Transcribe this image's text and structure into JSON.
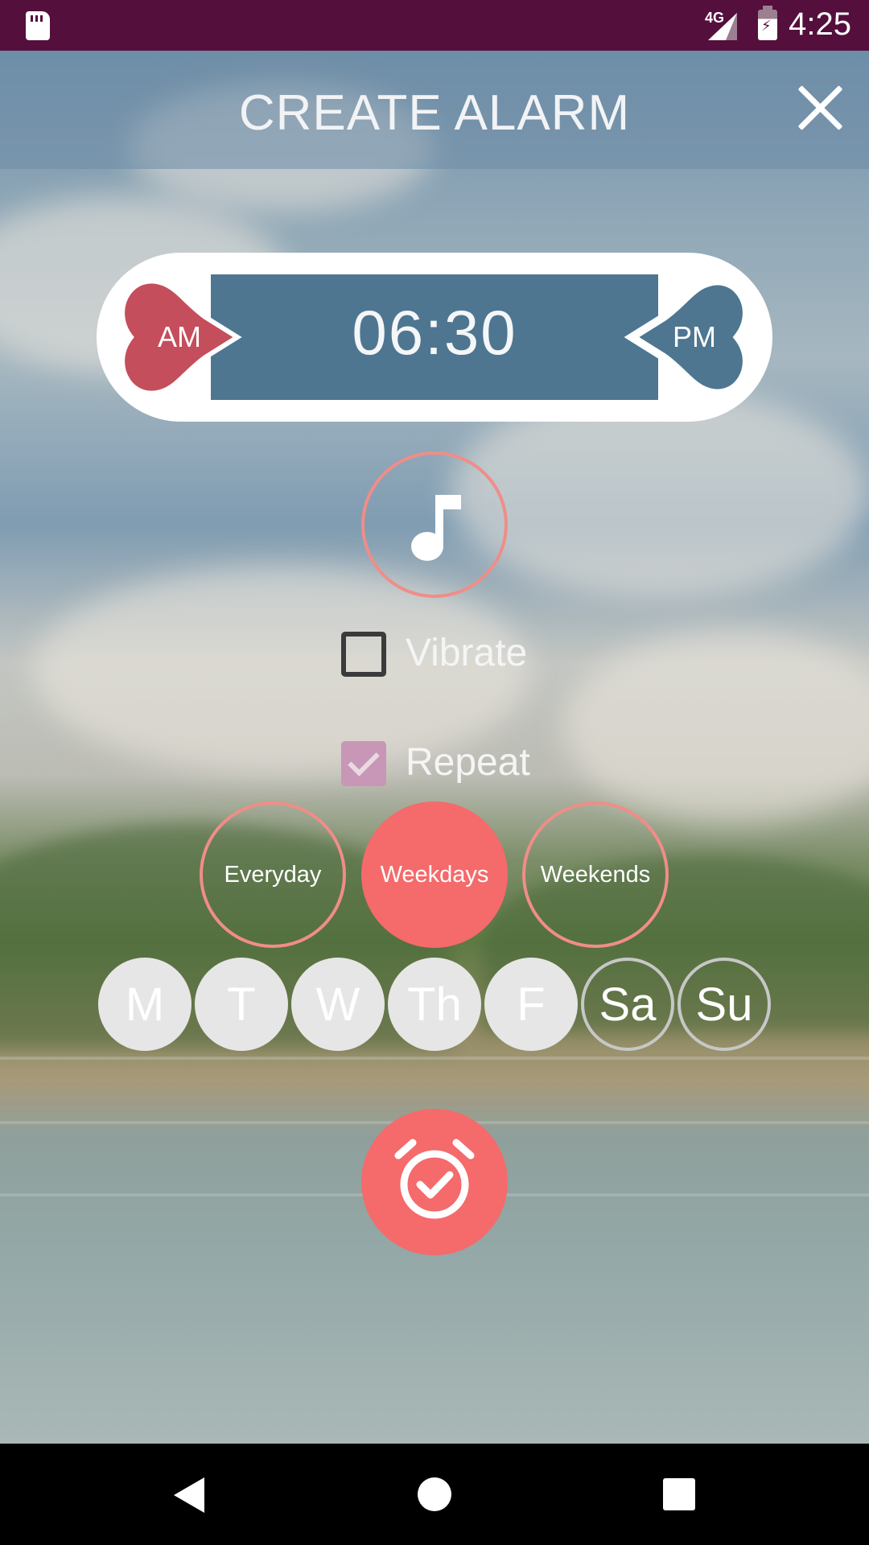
{
  "status_bar": {
    "network": "4G",
    "time": "4:25",
    "icons": [
      "sd-card-icon",
      "signal-icon",
      "battery-charging-icon"
    ]
  },
  "header": {
    "title": "CREATE ALARM",
    "close_icon": "close-icon"
  },
  "time_picker": {
    "time": "06:30",
    "am_label": "AM",
    "pm_label": "PM",
    "selected_period": "AM"
  },
  "sound": {
    "icon": "music-note-icon"
  },
  "vibrate": {
    "label": "Vibrate",
    "checked": false
  },
  "repeat": {
    "label": "Repeat",
    "checked": true,
    "presets": [
      {
        "label": "Everyday",
        "active": false
      },
      {
        "label": "Weekdays",
        "active": true
      },
      {
        "label": "Weekends",
        "active": false
      }
    ],
    "days": [
      {
        "label": "M",
        "selected": true
      },
      {
        "label": "T",
        "selected": true
      },
      {
        "label": "W",
        "selected": true
      },
      {
        "label": "Th",
        "selected": true
      },
      {
        "label": "F",
        "selected": true
      },
      {
        "label": "Sa",
        "selected": false
      },
      {
        "label": "Su",
        "selected": false
      }
    ]
  },
  "save": {
    "icon": "alarm-check-icon"
  },
  "colors": {
    "accent": "#f56a6b",
    "status_bar": "#540f3c",
    "time_field": "#4e7691",
    "am_heart": "#c44e5c",
    "pm_heart": "#4e7691"
  },
  "nav_bar": {
    "icons": [
      "back-icon",
      "home-icon",
      "recents-icon"
    ]
  }
}
